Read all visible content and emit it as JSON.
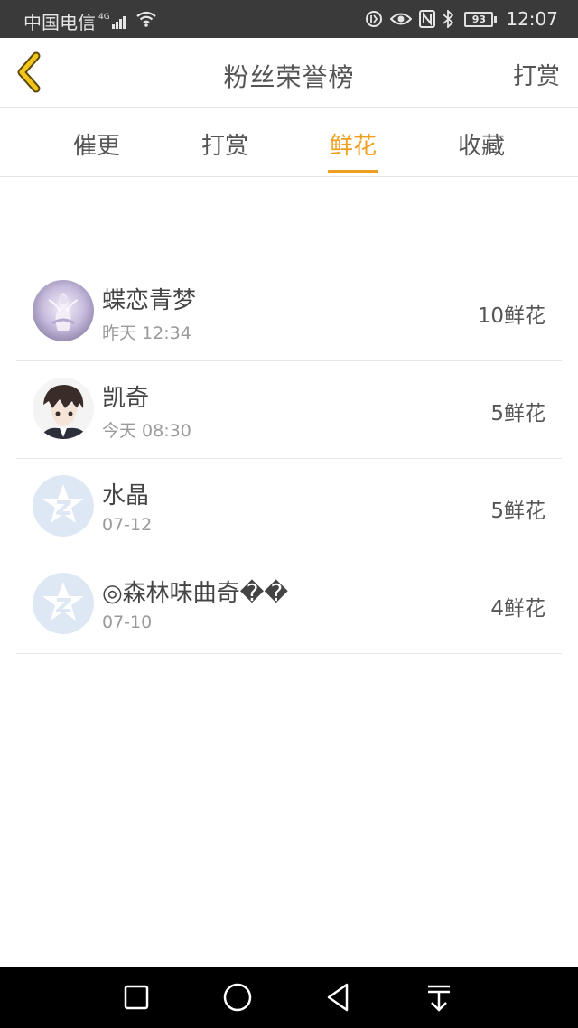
{
  "status_bar": {
    "carrier": "中国电信",
    "network": "4G",
    "battery": "93",
    "time": "12:07"
  },
  "header": {
    "title": "粉丝荣誉榜",
    "action_label": "打赏"
  },
  "tabs": [
    {
      "label": "催更"
    },
    {
      "label": "打赏"
    },
    {
      "label": "鲜花"
    },
    {
      "label": "收藏"
    }
  ],
  "active_tab": "鲜花",
  "fans": [
    {
      "name": "蝶恋青梦",
      "time": "昨天 12:34",
      "count": "10鲜花",
      "avatar": "anime-girl-avatar"
    },
    {
      "name": "凯奇",
      "time": "今天 08:30",
      "count": "5鲜花",
      "avatar": "anime-boy-avatar"
    },
    {
      "name": "水晶",
      "time": "07-12",
      "count": "5鲜花",
      "avatar": "default-qq-avatar"
    },
    {
      "name": "◎森林味曲奇��",
      "time": "07-10",
      "count": "4鲜花",
      "avatar": "default-qq-avatar"
    }
  ],
  "colors": {
    "accent": "#f0a020",
    "status_bar_bg": "#3a3a3a",
    "nav_bar_bg": "#000000",
    "text_primary": "#444444",
    "text_secondary": "#9a9a9a",
    "divider": "#e6e6e6"
  },
  "nav_bar": {
    "buttons": [
      "recent-apps-icon",
      "home-icon",
      "back-icon",
      "notification-pull-icon"
    ]
  }
}
